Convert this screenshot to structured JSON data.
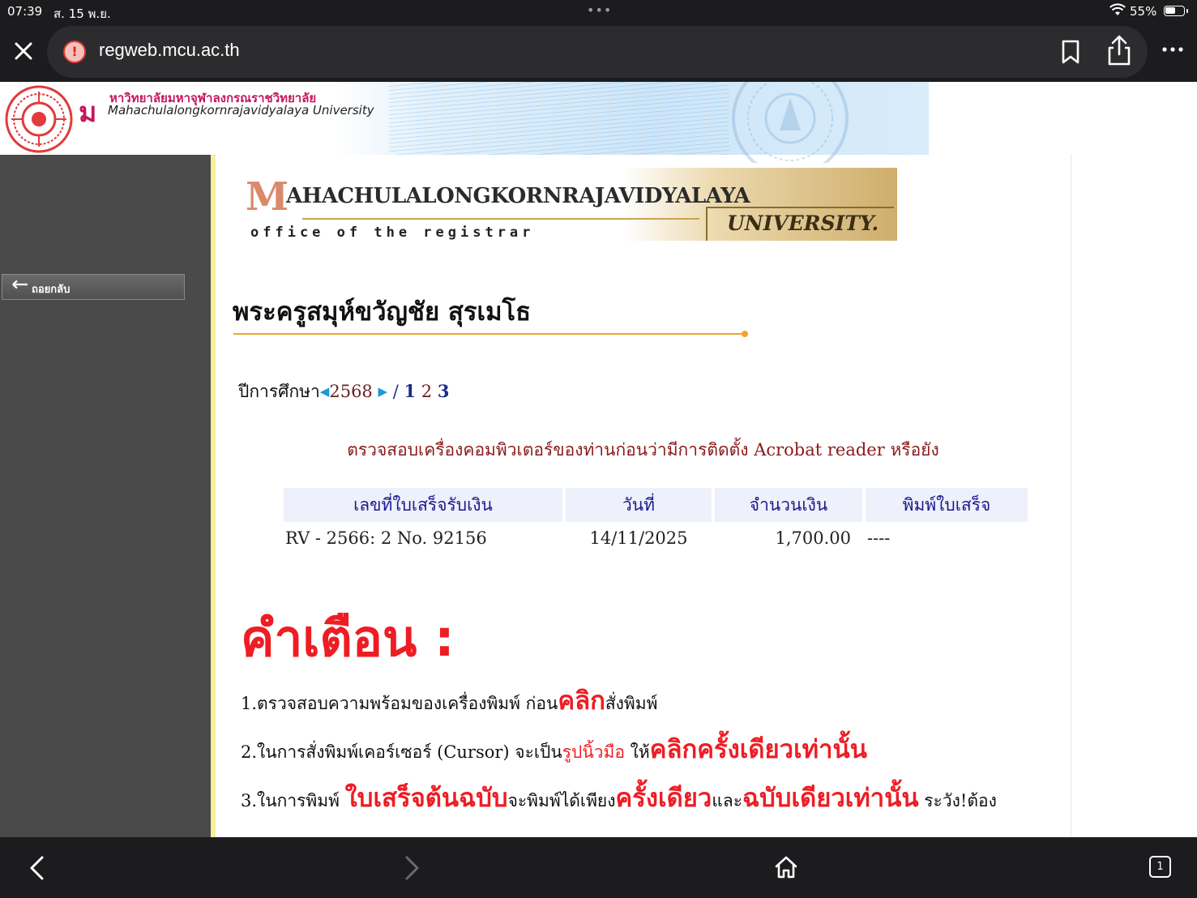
{
  "status_bar": {
    "time": "07:39",
    "date": "ส. 15 พ.ย.",
    "battery": "55%"
  },
  "browser": {
    "url": "regweb.mcu.ac.th",
    "tab_count": "1"
  },
  "header": {
    "university_th": "หาวิทยาลัยมหาจุฬาลงกรณราชวิทยาลัย",
    "university_en": "Mahachulalongkornrajavidyalaya University",
    "logo_mark": "ม"
  },
  "sidebar": {
    "back_label": "ถอยกลับ"
  },
  "registrar_banner": {
    "initial": "M",
    "title": "AHACHULALONGKORNRAJAVIDYALAYA",
    "subtitle": "office of the registrar",
    "university": "UNIVERSITY."
  },
  "student": {
    "name": "พระครูสมุห์ขวัญชัย สุรเมโธ"
  },
  "academic_year": {
    "label": "ปีการศึกษา",
    "year": "2568",
    "separator": "/",
    "semesters": [
      "1",
      "2",
      "3"
    ]
  },
  "notice": "ตรวจสอบเครื่องคอมพิวเตอร์ของท่านก่อนว่ามีการติดตั้ง Acrobat reader หรือยัง",
  "receipts": {
    "headers": [
      "เลขที่ใบเสร็จรับเงิน",
      "วันที่",
      "จำนวนเงิน",
      "พิมพ์ใบเสร็จ"
    ],
    "rows": [
      {
        "number": "RV - 2566: 2 No. 92156",
        "date": "14/11/2025",
        "amount": "1,700.00",
        "print": "----"
      }
    ]
  },
  "warning": {
    "title": "คำเตือน :",
    "item1": {
      "a": "1.ตรวจสอบความพร้อมของเครื่องพิมพ์ ก่อน",
      "b": "คลิก",
      "c": "สั่งพิมพ์"
    },
    "item2": {
      "a": "2.ในการสั่งพิมพ์เคอร์เซอร์ (Cursor) จะเป็น",
      "b": "รูปนิ้วมือ",
      "c": " ให้",
      "d": "คลิกครั้งเดียวเท่านั้น"
    },
    "item3": {
      "a": "3.ในการพิมพ์ ",
      "b": "ใบเสร็จต้นฉบับ",
      "c": "จะพิมพ์ได้เพียง",
      "d": "ครั้งเดียว",
      "e": "และ",
      "f": "ฉบับเดียวเท่านั้น",
      "g": " ระวัง!ต้อง"
    }
  },
  "colors": {
    "sidebar": "#4a4a4a",
    "accent_orange": "#f0a431",
    "warning_red": "#ee1d24",
    "notice_red": "#8b1a1a",
    "table_header_bg": "#eef0fb"
  }
}
